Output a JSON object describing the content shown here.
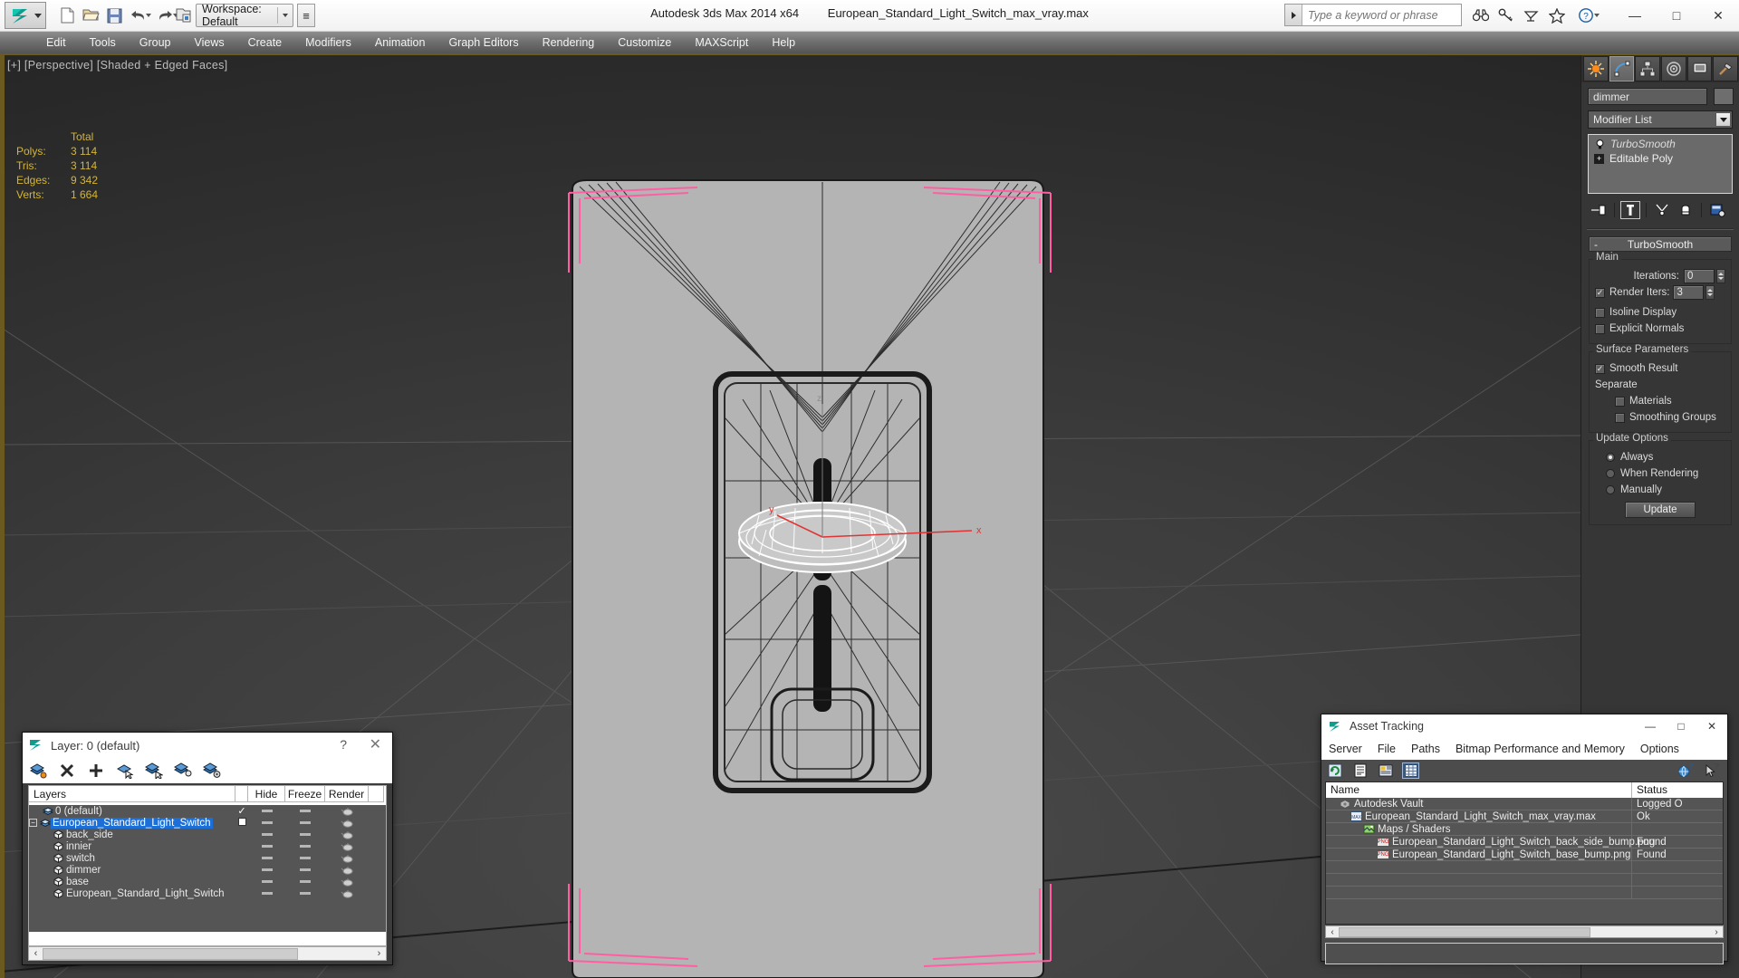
{
  "app": {
    "title": "Autodesk 3ds Max  2014 x64",
    "filename": "European_Standard_Light_Switch_max_vray.max",
    "workspace_label": "Workspace: Default",
    "workspace_more": "≡"
  },
  "quick_access": [
    {
      "name": "new-file-icon",
      "label": "New"
    },
    {
      "name": "open-file-icon",
      "label": "Open"
    },
    {
      "name": "save-file-icon",
      "label": "Save"
    },
    {
      "name": "undo-icon",
      "label": "Undo"
    },
    {
      "name": "redo-icon",
      "label": "Redo"
    },
    {
      "name": "set-project-folder-icon",
      "label": "Set Project Folder"
    }
  ],
  "search": {
    "placeholder": "Type a keyword or phrase",
    "value": ""
  },
  "info_icons": [
    {
      "name": "binoculars-icon",
      "label": "Search"
    },
    {
      "name": "key-icon",
      "label": "Licensing"
    },
    {
      "name": "satellite-dish-icon",
      "label": "Communication Center"
    },
    {
      "name": "star-icon",
      "label": "Favorites"
    },
    {
      "name": "help-icon",
      "label": "Help"
    }
  ],
  "window_controls": {
    "minimize": "—",
    "maximize": "□",
    "close": "✕"
  },
  "menu": [
    "Edit",
    "Tools",
    "Group",
    "Views",
    "Create",
    "Modifiers",
    "Animation",
    "Graph Editors",
    "Rendering",
    "Customize",
    "MAXScript",
    "Help"
  ],
  "viewport": {
    "label": "[+] [Perspective] [Shaded + Edged Faces]",
    "stats_header": "Total",
    "stats": [
      {
        "key": "Polys:",
        "value": "3 114"
      },
      {
        "key": "Tris:",
        "value": "3 114"
      },
      {
        "key": "Edges:",
        "value": "9 342"
      },
      {
        "key": "Verts:",
        "value": "1 664"
      }
    ],
    "axis_labels": {
      "x": "x",
      "y": "y",
      "z": "z"
    },
    "stats_color": "#d6b52e",
    "selection_color": "#ff5fa2"
  },
  "command_panel": {
    "tabs": [
      {
        "name": "create-tab",
        "selected": false
      },
      {
        "name": "modify-tab",
        "selected": true
      },
      {
        "name": "hierarchy-tab",
        "selected": false
      },
      {
        "name": "motion-tab",
        "selected": false
      },
      {
        "name": "display-tab",
        "selected": false
      },
      {
        "name": "utilities-tab",
        "selected": false
      }
    ],
    "object_name": "dimmer",
    "modifier_list_label": "Modifier List",
    "stack": [
      {
        "label": "TurboSmooth",
        "selected": true
      },
      {
        "label": "Editable Poly",
        "selected": false
      }
    ],
    "rollout": {
      "title": "TurboSmooth",
      "collapse_glyph": "-",
      "groups": [
        {
          "caption": "Main",
          "rows": [
            {
              "type": "spinner",
              "label": "Iterations:",
              "value": "0"
            },
            {
              "type": "checkspinner",
              "label": "Render Iters:",
              "value": "3",
              "checked": true
            },
            {
              "type": "checkbox",
              "label": "Isoline Display",
              "checked": false
            },
            {
              "type": "checkbox",
              "label": "Explicit Normals",
              "checked": false
            }
          ]
        },
        {
          "caption": "Surface Parameters",
          "rows": [
            {
              "type": "checkbox",
              "label": "Smooth Result",
              "checked": true
            },
            {
              "type": "text",
              "label": "Separate"
            },
            {
              "type": "checkbox-indent",
              "label": "Materials",
              "checked": false
            },
            {
              "type": "checkbox-indent",
              "label": "Smoothing Groups",
              "checked": false
            }
          ]
        },
        {
          "caption": "Update Options",
          "rows": [
            {
              "type": "radio",
              "label": "Always",
              "checked": true
            },
            {
              "type": "radio",
              "label": "When Rendering",
              "checked": false
            },
            {
              "type": "radio",
              "label": "Manually",
              "checked": false
            },
            {
              "type": "button",
              "label": "Update"
            }
          ]
        }
      ]
    }
  },
  "layer_dialog": {
    "title": "Layer: 0 (default)",
    "help_glyph": "?",
    "close_glyph": "✕",
    "toolbar": [
      {
        "name": "create-new-layer-icon"
      },
      {
        "name": "delete-layer-icon"
      },
      {
        "name": "add-selection-to-layer-icon"
      },
      {
        "name": "select-objects-in-layer-icon"
      },
      {
        "name": "set-current-layer-icon"
      },
      {
        "name": "select-highlighted-objects-icon"
      },
      {
        "name": "layer-properties-icon"
      }
    ],
    "columns": [
      "Layers",
      "",
      "Hide",
      "Freeze",
      "Render"
    ],
    "rows": [
      {
        "label": "0 (default)",
        "indent": 0,
        "type": "layer",
        "current": true,
        "box": false,
        "selected": false
      },
      {
        "label": "European_Standard_Light_Switch",
        "indent": 0,
        "type": "layer",
        "current": false,
        "box": true,
        "selected": true,
        "expander": "−"
      },
      {
        "label": "back_side",
        "indent": 1,
        "type": "object",
        "selected": false
      },
      {
        "label": "innier",
        "indent": 1,
        "type": "object",
        "selected": false
      },
      {
        "label": "switch",
        "indent": 1,
        "type": "object",
        "selected": false
      },
      {
        "label": "dimmer",
        "indent": 1,
        "type": "object",
        "selected": false
      },
      {
        "label": "base",
        "indent": 1,
        "type": "object",
        "selected": false
      },
      {
        "label": "European_Standard_Light_Switch",
        "indent": 1,
        "type": "object",
        "selected": false
      }
    ],
    "scroll_left": "‹",
    "scroll_right": "›"
  },
  "asset_tracking": {
    "title": "Asset Tracking",
    "window_controls": {
      "minimize": "—",
      "maximize": "□",
      "close": "✕"
    },
    "menu": [
      "Server",
      "File",
      "Paths",
      "Bitmap Performance and Memory",
      "Options"
    ],
    "toolbar": [
      {
        "name": "refresh-icon",
        "selected": false
      },
      {
        "name": "list-view-icon",
        "selected": false
      },
      {
        "name": "detail-view-icon",
        "selected": false
      },
      {
        "name": "grid-view-icon",
        "selected": true
      }
    ],
    "toolbar_right": [
      {
        "name": "help-globe-icon"
      },
      {
        "name": "help-cursor-icon"
      }
    ],
    "columns": [
      "Name",
      "Status"
    ],
    "rows": [
      {
        "name": "Autodesk Vault",
        "status": "Logged O",
        "indent": 0,
        "icon": "vault-icon"
      },
      {
        "name": "European_Standard_Light_Switch_max_vray.max",
        "status": "Ok",
        "indent": 1,
        "icon": "max-file-icon"
      },
      {
        "name": "Maps / Shaders",
        "status": "",
        "indent": 2,
        "icon": "maps-shaders-icon"
      },
      {
        "name": "European_Standard_Light_Switch_back_side_bump.png",
        "status": "Found",
        "indent": 3,
        "icon": "png-icon"
      },
      {
        "name": "European_Standard_Light_Switch_base_bump.png",
        "status": "Found",
        "indent": 3,
        "icon": "png-icon"
      },
      {
        "name": "",
        "status": "",
        "indent": 0,
        "icon": ""
      },
      {
        "name": "",
        "status": "",
        "indent": 0,
        "icon": ""
      },
      {
        "name": "",
        "status": "",
        "indent": 0,
        "icon": ""
      }
    ],
    "scroll_left": "‹",
    "scroll_right": "›"
  }
}
